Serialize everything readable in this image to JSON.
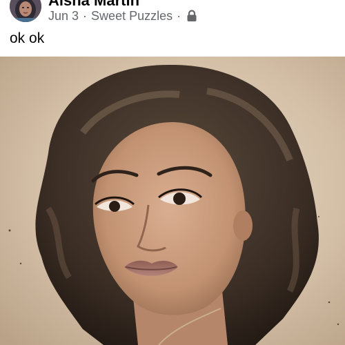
{
  "post": {
    "author": {
      "name": "Aisha Martin",
      "avatar_icon": "profile-photo"
    },
    "date": "Jun 3",
    "separator": "·",
    "group": "Sweet Puzzles",
    "privacy_icon": "lock-icon",
    "text": "ok ok",
    "photo": {
      "description_icon": "vintage-sepia-portrait",
      "tone": "#d6c3ab"
    }
  }
}
